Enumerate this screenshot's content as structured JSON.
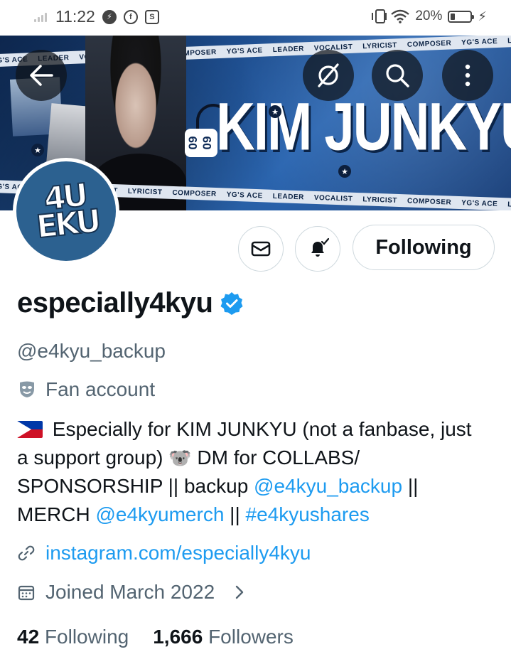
{
  "status_bar": {
    "time": "11:22",
    "battery_percent": "20%",
    "battery_level": 0.2,
    "notification_icons": [
      "messenger-icon",
      "facebook-icon",
      "screenshot-icon"
    ]
  },
  "banner": {
    "title": "KIM JUNKYU",
    "date_badge": "09 09",
    "tape_words": [
      "YG'S ACE",
      "LEADER",
      "VOCALIST",
      "LYRICIST",
      "COMPOSER"
    ],
    "avatar_logo_text": "4U EKU"
  },
  "actions": {
    "following_label": "Following"
  },
  "profile": {
    "display_name": "especially4kyu",
    "handle": "@e4kyu_backup",
    "category": "Fan account",
    "bio": {
      "part1": " Especially for KIM JUNKYU (not a fanbase, just a support group) ",
      "koala": "🐨",
      "part2": " DM for COLLABS/ SPONSORSHIP || backup ",
      "mention1": "@e4kyu_backup",
      "part3": " || MERCH ",
      "mention2": "@e4kyumerch",
      "part4": " || ",
      "hashtag": "#e4kyushares"
    },
    "website": "instagram.com/especially4kyu",
    "joined": "Joined March 2022",
    "following_count": "42",
    "following_label": "Following",
    "followers_count": "1,666",
    "followers_label": "Followers"
  },
  "colors": {
    "accent": "#1d9bf0",
    "text_primary": "#0f1419",
    "text_secondary": "#536471",
    "border": "#cfd9de",
    "banner_blue": "#1d4c8c"
  }
}
